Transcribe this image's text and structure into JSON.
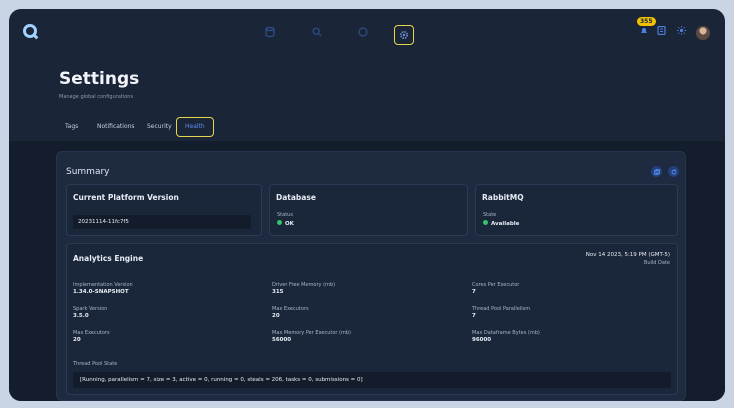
{
  "topbar": {
    "notifications_badge": "355",
    "nav_icons": [
      "database-icon",
      "search-icon",
      "info-icon",
      "settings-icon"
    ]
  },
  "header": {
    "title": "Settings",
    "subtitle": "Manage global configurations",
    "tabs": [
      {
        "label": "Tags"
      },
      {
        "label": "Notifications"
      },
      {
        "label": "Security"
      },
      {
        "label": "Health",
        "active": true
      }
    ]
  },
  "summary": {
    "title": "Summary",
    "platform": {
      "title": "Current Platform Version",
      "version": "20231114-11fc7f5"
    },
    "database": {
      "title": "Database",
      "status_label": "Status",
      "status_value": "OK"
    },
    "rabbitmq": {
      "title": "RabbitMQ",
      "state_label": "State",
      "state_value": "Available"
    },
    "analytics": {
      "title": "Analytics Engine",
      "build_date": "Nov 14 2023, 5:19 PM (GMT-5)",
      "build_date_label": "Build Date",
      "fields": [
        {
          "label": "Implementation Version",
          "value": "1.34.0-SNAPSHOT"
        },
        {
          "label": "Driver Free Memory (mb)",
          "value": "315"
        },
        {
          "label": "Cores Per Executor",
          "value": "7"
        },
        {
          "label": "Spark Version",
          "value": "3.5.0"
        },
        {
          "label": "Max Executors",
          "value": "20"
        },
        {
          "label": "Thread Pool Parallelism",
          "value": "7"
        },
        {
          "label": "Max Executors",
          "value": "20"
        },
        {
          "label": "Max Memory Per Executor (mb)",
          "value": "56000"
        },
        {
          "label": "Max Dataframe Bytes (mb)",
          "value": "96000"
        }
      ],
      "pool_label": "Thread Pool State",
      "pool_value": "[Running, parallelism = 7, size = 3, active = 0, running = 0, steals = 206, tasks = 0, submissions = 0]"
    }
  },
  "colors": {
    "accent": "#5b8ef0",
    "highlight": "#e8d64a",
    "ok": "#33c46a",
    "background": "#1b2538"
  }
}
